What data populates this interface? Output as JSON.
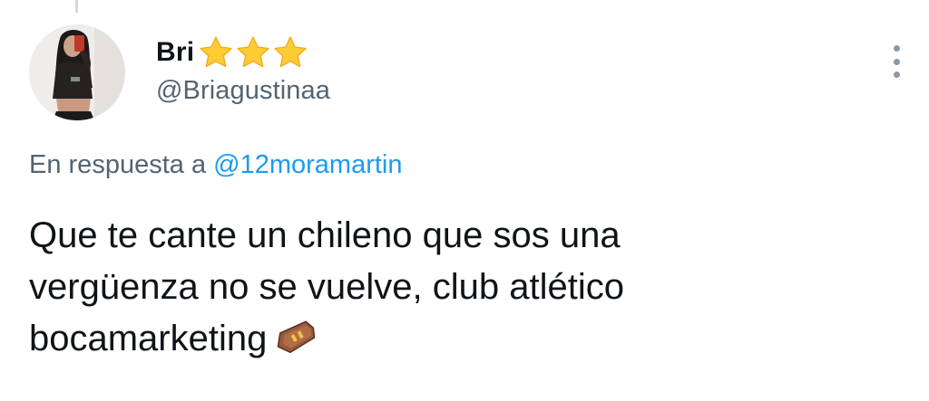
{
  "tweet": {
    "display_name": "Bri",
    "badges": [
      "star-icon",
      "star-icon",
      "star-icon"
    ],
    "handle": "@Briagustinaa",
    "reply_prefix": "En respuesta a",
    "reply_mention": "@12moramartin",
    "text_lines": [
      "Que te cante un chileno que sos una",
      "vergüenza no se vuelve, club atlético",
      "bocamarketing"
    ],
    "trailing_emoji": "coffin-icon"
  },
  "colors": {
    "text_primary": "#0f1419",
    "text_secondary": "#536471",
    "link": "#1d9bf0",
    "star": "#ffcc33",
    "thread_line": "#cfd9de"
  }
}
